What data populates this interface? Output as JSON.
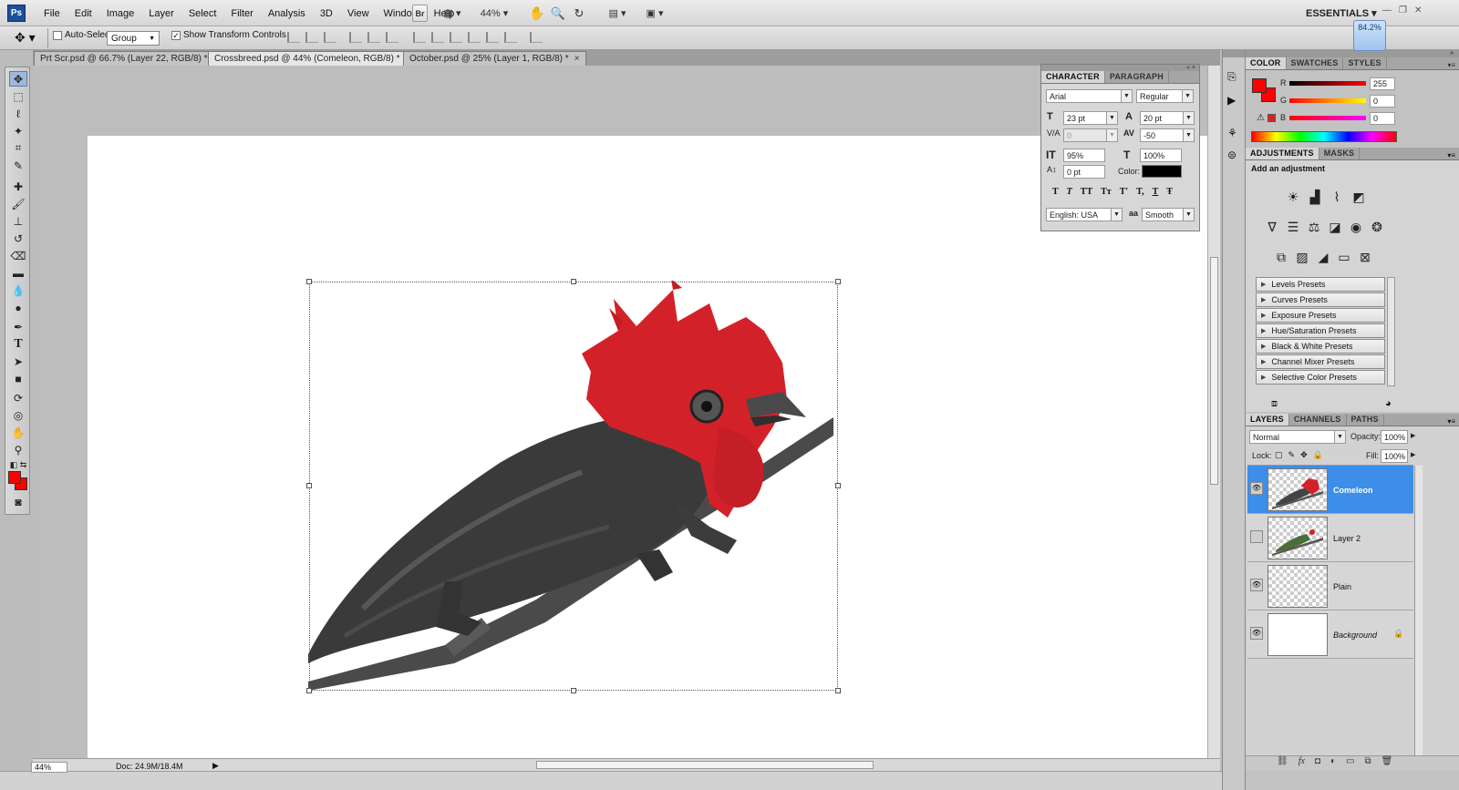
{
  "app": {
    "logo": "Ps",
    "workspace": "ESSENTIALS",
    "zoom_indicator": "84.2%"
  },
  "menu": [
    "File",
    "Edit",
    "Image",
    "Layer",
    "Select",
    "Filter",
    "Analysis",
    "3D",
    "View",
    "Window",
    "Help"
  ],
  "app_bar": {
    "bridge": "Br",
    "zoom": "44%"
  },
  "options_bar": {
    "auto_select_label": "Auto-Select:",
    "auto_select_value": "Group",
    "show_transform_label": "Show Transform Controls"
  },
  "doc_tabs": [
    {
      "label": "Prt Scr.psd @ 66.7% (Layer 22, RGB/8) *",
      "active": false
    },
    {
      "label": "Crossbreed.psd @ 44% (Comeleon, RGB/8) *",
      "active": true
    },
    {
      "label": "October.psd @ 25% (Layer 1, RGB/8) *",
      "active": false
    }
  ],
  "status": {
    "zoom": "44%",
    "doc_size": "Doc: 24.9M/18.4M"
  },
  "character": {
    "tabs": [
      "CHARACTER",
      "PARAGRAPH"
    ],
    "font_family": "Arial",
    "font_style": "Regular",
    "size": "23 pt",
    "leading": "20 pt",
    "kerning": "0",
    "tracking": "-50",
    "vertical_scale": "95%",
    "horizontal_scale": "100%",
    "baseline_shift": "0 pt",
    "color_label": "Color:",
    "language": "English: USA",
    "antialias_label": "aa",
    "antialias": "Smooth",
    "style_buttons": [
      "T",
      "T",
      "TT",
      "Tт",
      "T'",
      "T,",
      "T",
      "Ŧ"
    ]
  },
  "color_panel": {
    "tabs": [
      "COLOR",
      "SWATCHES",
      "STYLES"
    ],
    "r_label": "R",
    "g_label": "G",
    "b_label": "B",
    "r": "255",
    "g": "0",
    "b": "0",
    "foreground": "#ff0000"
  },
  "adjustments": {
    "tabs": [
      "ADJUSTMENTS",
      "MASKS"
    ],
    "heading": "Add an adjustment",
    "presets": [
      "Levels Presets",
      "Curves Presets",
      "Exposure Presets",
      "Hue/Saturation Presets",
      "Black & White Presets",
      "Channel Mixer Presets",
      "Selective Color Presets"
    ]
  },
  "layers_panel": {
    "tabs": [
      "LAYERS",
      "CHANNELS",
      "PATHS"
    ],
    "blend_mode": "Normal",
    "opacity_label": "Opacity:",
    "opacity": "100%",
    "lock_label": "Lock:",
    "fill_label": "Fill:",
    "fill": "100%",
    "layers": [
      {
        "name": "Comeleon",
        "visible": true,
        "selected": true
      },
      {
        "name": "Layer 2",
        "visible": false,
        "selected": false
      },
      {
        "name": "Plain",
        "visible": true,
        "selected": false
      },
      {
        "name": "Background",
        "visible": true,
        "selected": false,
        "locked": true
      }
    ]
  },
  "colors": {
    "accent": "#3d8ee8",
    "foreground_swatch": "#ff0000"
  }
}
